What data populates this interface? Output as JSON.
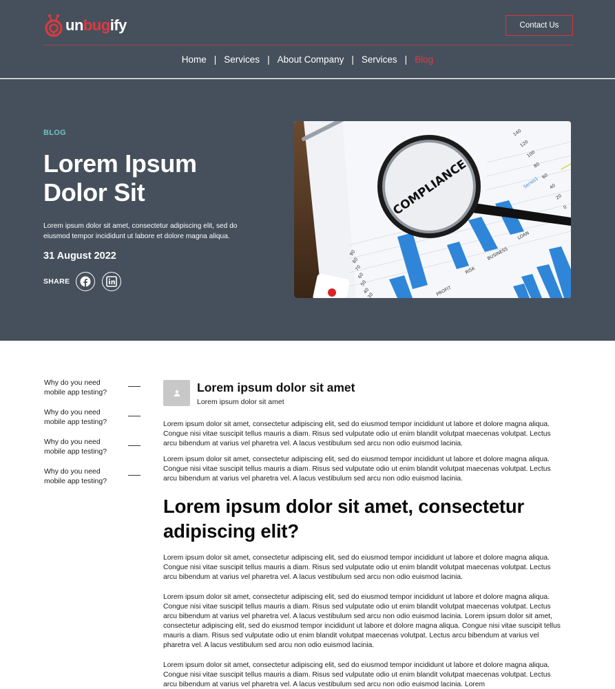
{
  "header": {
    "logo_text_white_1": "un",
    "logo_text_red": "bug",
    "logo_text_white_2": "ify",
    "contact_label": "Contact Us",
    "nav": [
      {
        "label": "Home"
      },
      {
        "label": "Services"
      },
      {
        "label": "About Company"
      },
      {
        "label": "Services"
      },
      {
        "label": "Blog"
      }
    ],
    "nav_separator": "|"
  },
  "hero": {
    "kicker": "BLOG",
    "title": "Lorem Ipsum Dolor Sit",
    "description": "Lorem ipsum dolor sit amet, consectetur adipiscing elit, sed do eiusmod tempor incididunt ut labore et dolore magna aliqua.",
    "date": "31 August 2022",
    "share_label": "SHARE",
    "image_caption": "COMPLIANCE",
    "image_axis_labels": [
      "140",
      "120",
      "100",
      "80",
      "60",
      "40",
      "20",
      "0"
    ],
    "image_left_axis": [
      "90",
      "80",
      "70",
      "60",
      "50",
      "40",
      "30"
    ],
    "image_categories": [
      "PROFIT",
      "RISK",
      "BUSINESS",
      "LOAN"
    ],
    "image_series_label": "Series1"
  },
  "toc": {
    "items": [
      {
        "label": "Why do you need mobile app testing?"
      },
      {
        "label": "Why do you need mobile app testing?"
      },
      {
        "label": "Why do you need mobile app testing?"
      },
      {
        "label": "Why do you need mobile app testing?"
      }
    ]
  },
  "article": {
    "author_title": "Lorem ipsum dolor sit amet",
    "author_subtitle": "Lorem ipsum dolor sit amet",
    "p1": "Lorem ipsum dolor sit amet, consectetur adipiscing elit, sed do eiusmod tempor incididunt ut labore et dolore magna aliqua. Congue nisi vitae suscipit tellus mauris a diam. Risus sed vulputate odio ut enim blandit volutpat maecenas volutpat. Lectus arcu bibendum at varius vel pharetra vel. A lacus vestibulum sed arcu non odio euismod lacinia.",
    "p2": "Lorem ipsum dolor sit amet, consectetur adipiscing elit, sed do eiusmod tempor incididunt ut labore et dolore magna aliqua. Congue nisi vitae suscipit tellus mauris a diam. Risus sed vulputate odio ut enim blandit volutpat maecenas volutpat. Lectus arcu bibendum at varius vel pharetra vel. A lacus vestibulum sed arcu non odio euismod lacinia.",
    "heading": "Lorem ipsum dolor sit amet, consectetur adipiscing elit?",
    "p3": "Lorem ipsum dolor sit amet, consectetur adipiscing elit, sed do eiusmod tempor incididunt ut labore et dolore magna aliqua. Congue nisi vitae suscipit tellus mauris a diam. Risus sed vulputate odio ut enim blandit volutpat maecenas volutpat. Lectus arcu bibendum at varius vel pharetra vel. A lacus vestibulum sed arcu non odio euismod lacinia.",
    "p4": "Lorem ipsum dolor sit amet, consectetur adipiscing elit, sed do eiusmod tempor incididunt ut labore et dolore magna aliqua. Congue nisi vitae suscipit tellus mauris a diam. Risus sed vulputate odio ut enim blandit volutpat maecenas volutpat. Lectus arcu bibendum at varius vel pharetra vel. A lacus vestibulum sed arcu non odio euismod lacinia.  Lorem ipsum dolor sit amet, consectetur adipiscing elit, sed do eiusmod tempor incididunt ut labore et dolore magna aliqua. Congue nisi vitae suscipit tellus mauris a diam. Risus sed vulputate odio ut enim blandit volutpat maecenas volutpat. Lectus arcu bibendum at varius vel pharetra vel. A lacus vestibulum sed arcu non odio euismod lacinia.",
    "p5": "Lorem ipsum dolor sit amet, consectetur adipiscing elit, sed do eiusmod tempor incididunt ut labore et dolore magna aliqua. Congue nisi vitae suscipit tellus mauris a diam. Risus sed vulputate odio ut enim blandit volutpat maecenas volutpat. Lectus arcu bibendum at varius vel pharetra vel. A lacus vestibulum sed arcu non odio euismod lacinia.  Lorem"
  },
  "colors": {
    "header_bg": "#46505c",
    "accent_red": "#e0393e",
    "kicker_teal": "#6fc3c2",
    "chart_blue": "#2f86d8"
  },
  "icons": {
    "logo": "bug-logo-icon",
    "share_1": "facebook-icon",
    "share_2": "linkedin-icon",
    "avatar": "user-icon",
    "hero_image": "magnifier-chart-photo"
  }
}
